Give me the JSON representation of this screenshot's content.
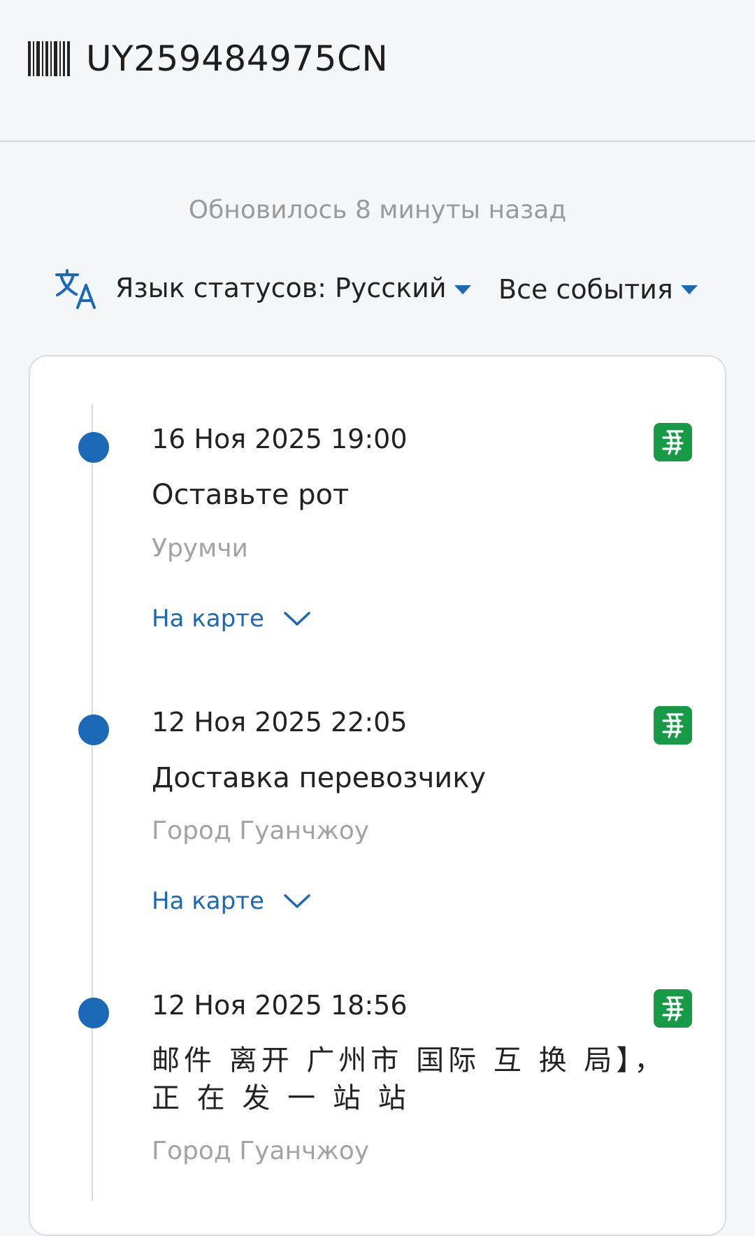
{
  "header": {
    "icon": "barcode-icon",
    "tracking_number": "UY259484975CN"
  },
  "updated_text": "Обновилось 8 минуты назад",
  "filters": {
    "translate_icon": "translate-icon",
    "language_label": "Язык статусов: Русский",
    "events_label": "Все события",
    "caret_icon": "caret-down-icon"
  },
  "colors": {
    "accent": "#1b68b7",
    "carrier_green": "#179a46",
    "background": "#f4f7fa",
    "muted_text": "#a3a3a3"
  },
  "events": [
    {
      "date": "16 Ноя 2025 19:00",
      "status": "Оставьте рот",
      "place": "Урумчи",
      "map_label": "На карте",
      "carrier_icon": "china-post-logo"
    },
    {
      "date": "12 Ноя 2025 22:05",
      "status": "Доставка перевозчику",
      "place": "Город Гуанчжоу",
      "map_label": "На карте",
      "carrier_icon": "china-post-logo"
    },
    {
      "date": "12 Ноя 2025 18:56",
      "status": "邮件 离开 广州市 国际 互 换 局】， 正 在 发 一 站 站",
      "place": "Город Гуанчжоу",
      "carrier_icon": "china-post-logo"
    }
  ]
}
